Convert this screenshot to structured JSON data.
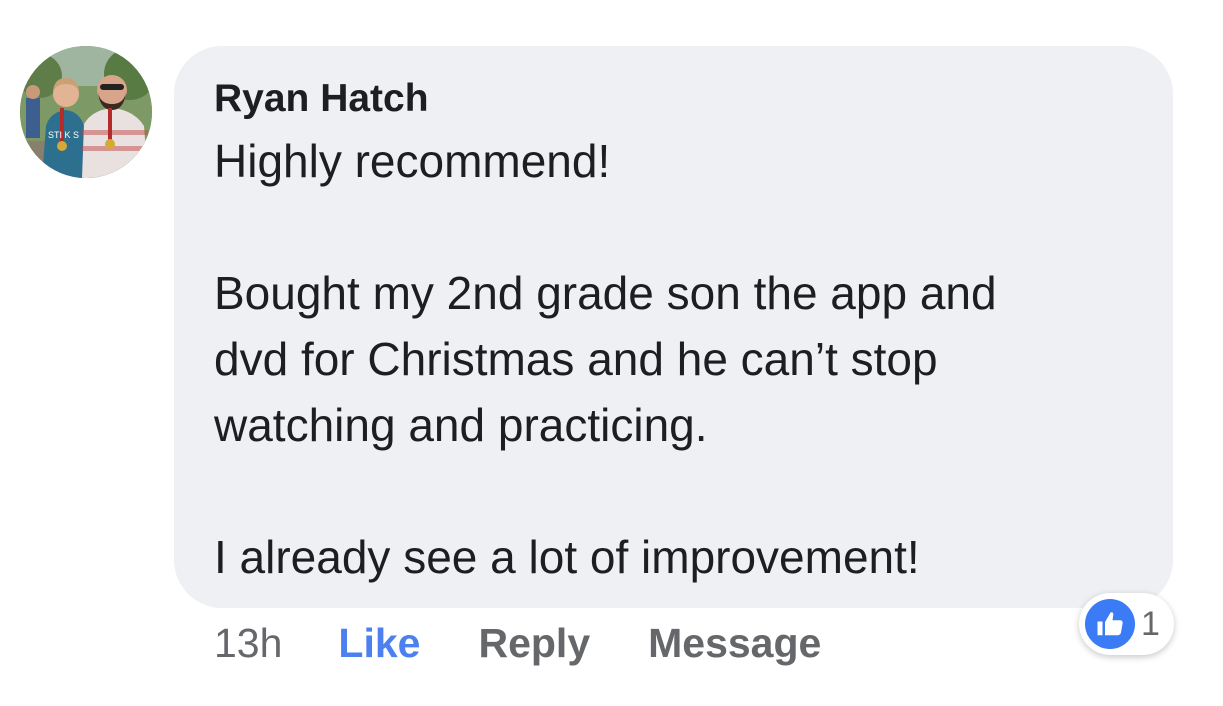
{
  "comment": {
    "author": "Ryan Hatch",
    "lines": [
      "Highly recommend!",
      "Bought my 2nd grade son the app and",
      "dvd for Christmas and he can’t stop",
      "watching and practicing.",
      "I already see a lot of improvement!"
    ],
    "avatar_icon": "profile-photo-avatar",
    "avatar_shirt_text": "STI K S"
  },
  "actions": {
    "time": "13h",
    "like": "Like",
    "reply": "Reply",
    "message": "Message"
  },
  "reactions": {
    "icon": "thumbs-up-icon",
    "count": "1"
  },
  "colors": {
    "bubble": "#eff0f3",
    "like_blue": "#4c80ee",
    "badge_blue": "#3b7bf5",
    "text": "#1c1e21",
    "muted": "#65676b"
  }
}
